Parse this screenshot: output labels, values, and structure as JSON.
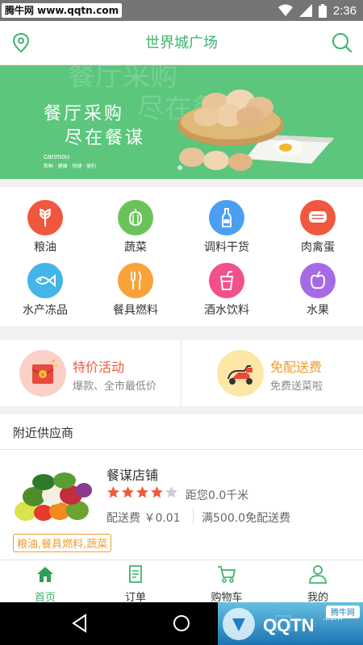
{
  "status_bar": {
    "watermark": "腾牛网 www.qqtn.com",
    "time": "2:36"
  },
  "header": {
    "title": "世界城广场",
    "left_icon": "location-pin-icon",
    "right_icon": "search-icon"
  },
  "banner": {
    "line1": "餐厅采购",
    "line2": "尽在餐谋",
    "brand": "canmou",
    "slogan": "新鲜 · 健康 · 快捷 · 便利",
    "ghost_left": "餐厅采购",
    "ghost_right": "尽在餐谋",
    "bg_color": "#5bc67c"
  },
  "categories": [
    {
      "label": "粮油",
      "icon": "wheat-icon",
      "color": "#f0573f"
    },
    {
      "label": "蔬菜",
      "icon": "pepper-icon",
      "color": "#6cc25a"
    },
    {
      "label": "调料干货",
      "icon": "bottle-icon",
      "color": "#4b9ff0"
    },
    {
      "label": "肉禽蛋",
      "icon": "meat-icon",
      "color": "#f0573f"
    },
    {
      "label": "水产冻品",
      "icon": "fish-icon",
      "color": "#43b5e8"
    },
    {
      "label": "餐具燃料",
      "icon": "cutlery-icon",
      "color": "#f7a33a"
    },
    {
      "label": "酒水饮料",
      "icon": "drink-icon",
      "color": "#f2508d"
    },
    {
      "label": "水果",
      "icon": "apple-icon",
      "color": "#a56be6"
    }
  ],
  "promos": {
    "special": {
      "title": "特价活动",
      "subtitle": "爆款、全市最低价",
      "title_color": "#f0573f",
      "icon": "red-envelope-icon"
    },
    "free_delivery": {
      "title": "免配送费",
      "subtitle": "免费送菜啦",
      "title_color": "#f39a2b",
      "icon": "scooter-icon"
    }
  },
  "nearby": {
    "heading": "附近供应商",
    "stores": [
      {
        "name": "餐谋店铺",
        "rating": 4,
        "max_rating": 5,
        "distance": "距您0.0千米",
        "delivery_fee": "配送费 ￥0.01",
        "free_delivery": "满500.0免配送费",
        "tags": "粮油,餐具燃料,蔬菜"
      }
    ]
  },
  "bottom_nav": [
    {
      "label": "首页",
      "icon": "home-icon",
      "active": true
    },
    {
      "label": "订单",
      "icon": "order-icon",
      "active": false
    },
    {
      "label": "购物车",
      "icon": "cart-icon",
      "active": false
    },
    {
      "label": "我的",
      "icon": "profile-icon",
      "active": false
    }
  ],
  "colors": {
    "accent": "#3bb46d",
    "star": "#f05a3c",
    "tag": "#f39a2b"
  },
  "watermark_bottom": "腾牛网"
}
